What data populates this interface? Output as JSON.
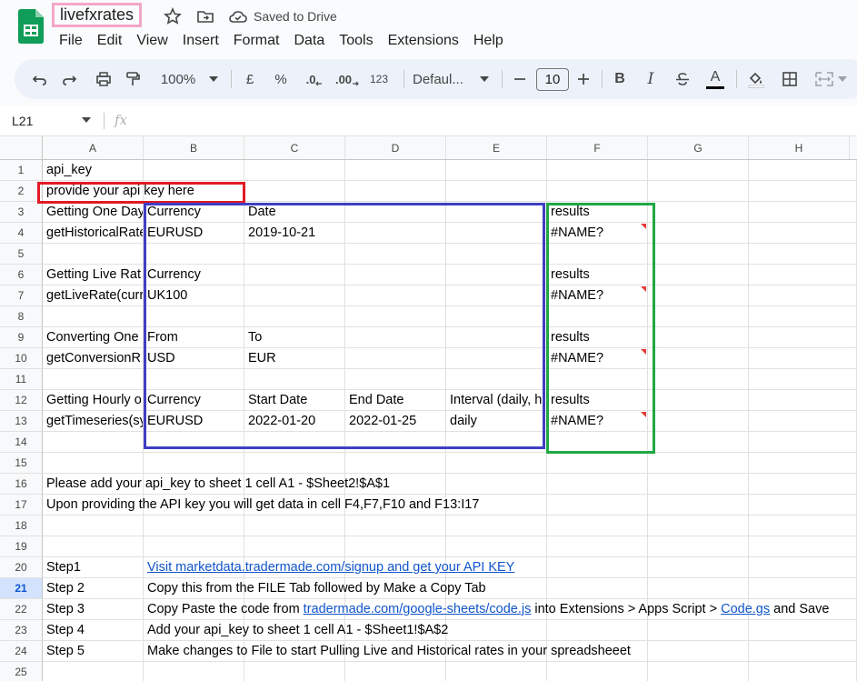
{
  "document": {
    "title": "livefxrates",
    "saved_status": "Saved to Drive"
  },
  "menu": [
    "File",
    "Edit",
    "View",
    "Insert",
    "Format",
    "Data",
    "Tools",
    "Extensions",
    "Help"
  ],
  "toolbar": {
    "zoom": "100%",
    "currency_symbol": "£",
    "percent_symbol": "%",
    "decrease_decimal": ".0",
    "increase_decimal": ".00",
    "number_format": "123",
    "font": "Defaul...",
    "font_size": "10",
    "bold": "B",
    "italic": "I",
    "text_color": "A"
  },
  "formula_bar": {
    "cell_ref": "L21",
    "fx": "fx",
    "value": ""
  },
  "columns": [
    "A",
    "B",
    "C",
    "D",
    "E",
    "F",
    "G",
    "H"
  ],
  "active_row": 21,
  "colors": {
    "pink_box": "#f4a6c8",
    "red_box": "#e01b24",
    "blue_box": "#3f3fc4",
    "green_box": "#1fa845",
    "link": "#1155cc"
  },
  "rows": [
    {
      "n": "1",
      "A": "api_key"
    },
    {
      "n": "2",
      "A": "provide your api key here"
    },
    {
      "n": "3",
      "A": "Getting One Day",
      "B": "Currency",
      "C": "Date",
      "F": "results"
    },
    {
      "n": "4",
      "A": "getHistoricalRate",
      "B": "EURUSD",
      "C": "2019-10-21",
      "F": "#NAME?"
    },
    {
      "n": "5"
    },
    {
      "n": "6",
      "A": "Getting Live Rat",
      "B": "Currency",
      "F": "results"
    },
    {
      "n": "7",
      "A": "getLiveRate(curr",
      "B": "UK100",
      "F": "#NAME?"
    },
    {
      "n": "8"
    },
    {
      "n": "9",
      "A": "Converting One",
      "B": "From",
      "C": "To",
      "F": "results"
    },
    {
      "n": "10",
      "A": "getConversionR",
      "B": "USD",
      "C": "EUR",
      "F": "#NAME?"
    },
    {
      "n": "11"
    },
    {
      "n": "12",
      "A": "Getting Hourly o",
      "B": "Currency",
      "C": "Start Date",
      "D": "End Date",
      "E": "Interval (daily, h",
      "F": "results"
    },
    {
      "n": "13",
      "A": "getTimeseries(sy",
      "B": "EURUSD",
      "C": "2022-01-20",
      "D": "2022-01-25",
      "E": "daily",
      "F": "#NAME?"
    },
    {
      "n": "14"
    },
    {
      "n": "15"
    },
    {
      "n": "16",
      "A": "Please add your api_key to sheet 1 cell A1 - $Sheet2!$A$1"
    },
    {
      "n": "17",
      "A": "Upon providing the API key you will get data in cell F4,F7,F10 and F13:I17"
    },
    {
      "n": "18"
    },
    {
      "n": "19"
    },
    {
      "n": "20",
      "A": "Step1",
      "B_link": "Visit marketdata.tradermade.com/signup and get your API KEY"
    },
    {
      "n": "21",
      "A": "Step 2",
      "B": "Copy this from the FILE Tab followed by Make a Copy Tab"
    },
    {
      "n": "22",
      "A": "Step 3",
      "B_pre": "Copy Paste the code from ",
      "B_link": "tradermade.com/google-sheets/code.js",
      "B_mid": " into Extensions > Apps Script > ",
      "B_link2": "Code.gs",
      "B_post": " and Save"
    },
    {
      "n": "23",
      "A": "Step 4",
      "B": "Add your api_key to sheet 1 cell A1 - $Sheet1!$A$2"
    },
    {
      "n": "24",
      "A": "Step 5",
      "B": "Make changes to File to start Pulling Live and Historical rates in your spreadsheeet"
    },
    {
      "n": "25"
    }
  ]
}
